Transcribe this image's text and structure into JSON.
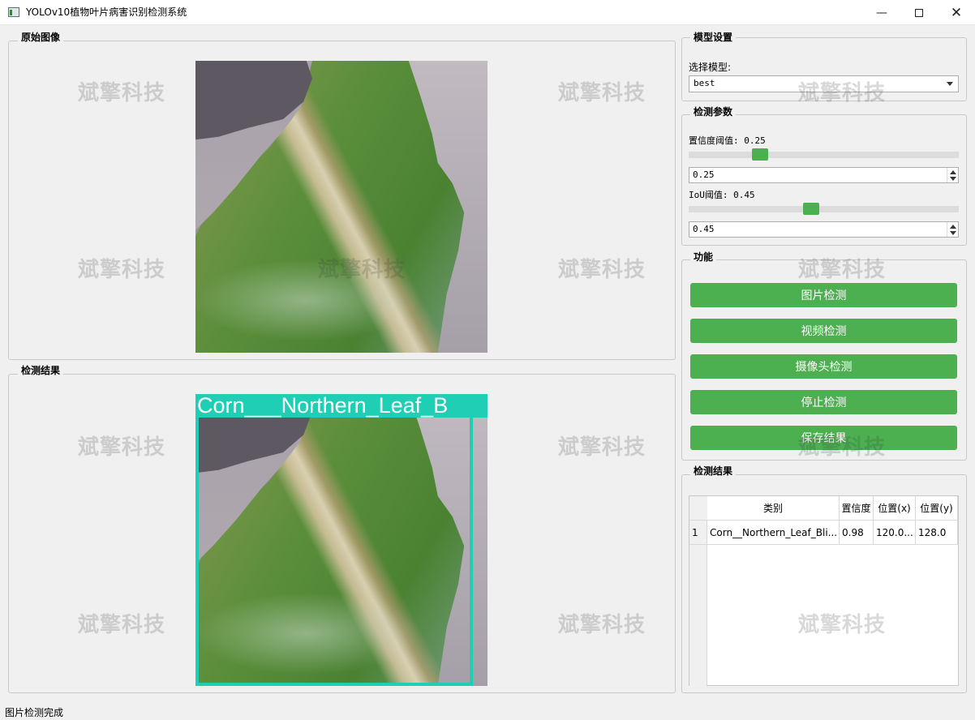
{
  "window": {
    "title": "YOLOv10植物叶片病害识别检测系统"
  },
  "watermark": "斌擎科技",
  "original": {
    "title": "原始图像"
  },
  "detection": {
    "title": "检测结果",
    "label": "Corn___Northern_Leaf_B"
  },
  "model": {
    "title": "模型设置",
    "select_label": "选择模型:",
    "selected": "best"
  },
  "params": {
    "title": "检测参数",
    "confidence_label": "置信度阈值: 0.25",
    "confidence_value": "0.25",
    "confidence_level": 0.25,
    "iou_label": "IoU阈值: 0.45",
    "iou_value": "0.45",
    "iou_level": 0.45
  },
  "functions": {
    "title": "功能",
    "buttons": [
      "图片检测",
      "视频检测",
      "摄像头检测",
      "停止检测",
      "保存结果"
    ]
  },
  "results": {
    "title": "检测结果",
    "headers": [
      "类别",
      "置信度",
      "位置(x)",
      "位置(y)"
    ],
    "rows": [
      {
        "index": "1",
        "class": "Corn__Northern_Leaf_Bli...",
        "confidence": "0.98",
        "x": "120.0...",
        "y": "128.0"
      }
    ]
  },
  "status": {
    "text": "图片检测完成"
  },
  "colors": {
    "accent": "#4caf50",
    "box": "#1fcfb5"
  }
}
